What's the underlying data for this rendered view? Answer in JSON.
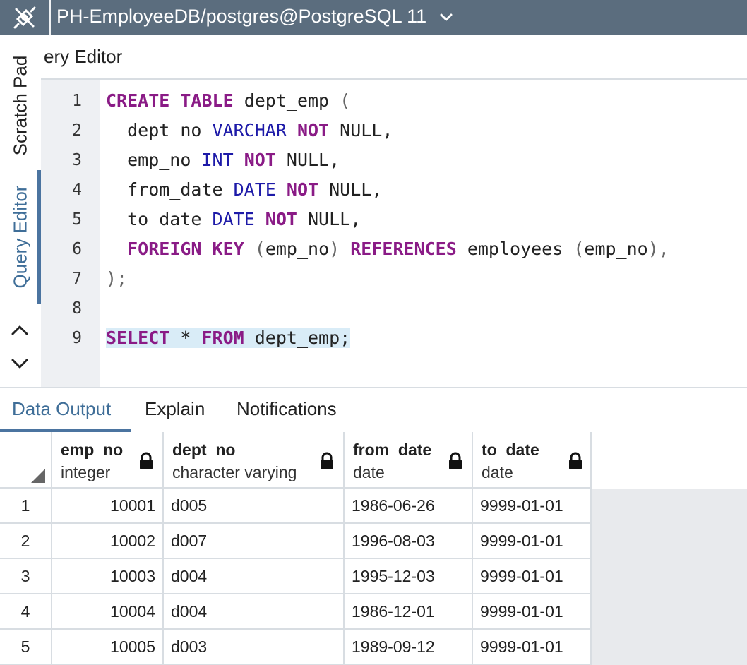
{
  "topbar": {
    "connection_title": "PH-EmployeeDB/postgres@PostgreSQL 11",
    "connection_icon": "plug-disconnect-icon",
    "dropdown_icon": "chevron-down-icon",
    "bg_color": "#5b6d7e"
  },
  "side_tabs": {
    "scratch_pad": "Scratch Pad",
    "query_editor": "Query Editor"
  },
  "panel_title": "ery Editor",
  "editor": {
    "line_numbers": [
      "1",
      "2",
      "3",
      "4",
      "5",
      "6",
      "7",
      "8",
      "9"
    ]
  },
  "bottom_tabs": {
    "data_output": "Data Output",
    "explain": "Explain",
    "notifications": "Notifications"
  },
  "grid": {
    "columns": [
      {
        "name": "emp_no",
        "type": "integer"
      },
      {
        "name": "dept_no",
        "type": "character varying"
      },
      {
        "name": "from_date",
        "type": "date"
      },
      {
        "name": "to_date",
        "type": "date"
      }
    ],
    "rows": [
      {
        "n": "1",
        "emp_no": "10001",
        "dept_no": "d005",
        "from_date": "1986-06-26",
        "to_date": "9999-01-01"
      },
      {
        "n": "2",
        "emp_no": "10002",
        "dept_no": "d007",
        "from_date": "1996-08-03",
        "to_date": "9999-01-01"
      },
      {
        "n": "3",
        "emp_no": "10003",
        "dept_no": "d004",
        "from_date": "1995-12-03",
        "to_date": "9999-01-01"
      },
      {
        "n": "4",
        "emp_no": "10004",
        "dept_no": "d004",
        "from_date": "1986-12-01",
        "to_date": "9999-01-01"
      },
      {
        "n": "5",
        "emp_no": "10005",
        "dept_no": "d003",
        "from_date": "1989-09-12",
        "to_date": "9999-01-01"
      }
    ]
  },
  "code": {
    "l1": {
      "k1": "CREATE",
      "k2": "TABLE",
      "t1": " dept_emp ",
      "p1": "("
    },
    "l2": {
      "t1": "  dept_no ",
      "ty1": "VARCHAR",
      "k1": "NOT",
      "t2": " NULL,"
    },
    "l3": {
      "t1": "  emp_no ",
      "ty1": "INT",
      "k1": "NOT",
      "t2": " NULL,"
    },
    "l4": {
      "t1": "  from_date ",
      "ty1": "DATE",
      "k1": "NOT",
      "t2": " NULL,"
    },
    "l5": {
      "t1": "  to_date ",
      "ty1": "DATE",
      "k1": "NOT",
      "t2": " NULL,"
    },
    "l6": {
      "t1": "  ",
      "k1": "FOREIGN",
      "k2": "KEY",
      "p1": "(",
      "t2": "emp_no",
      "p2": ")",
      "k3": "REFERENCES",
      "t3": " employees ",
      "p3": "(",
      "t4": "emp_no",
      "p4": "),"
    },
    "l7": {
      "p1": ");"
    },
    "l9": {
      "k1": "SELECT",
      "p1": " * ",
      "k2": "FROM",
      "t1": " dept_emp;"
    }
  },
  "colors": {
    "keyword": "#8a1b86",
    "type": "#1d1aa8",
    "accent": "#4b74a0",
    "selection": "#d9ecf7"
  }
}
